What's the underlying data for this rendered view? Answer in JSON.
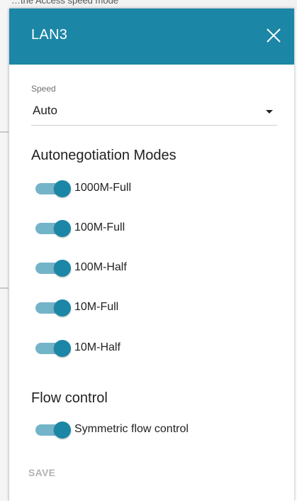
{
  "background": {
    "partial_text": "…the Access speed mode"
  },
  "dialog": {
    "title": "LAN3",
    "close_icon": "close-icon",
    "header_color": "#1b86a6"
  },
  "speed": {
    "label": "Speed",
    "value": "Auto"
  },
  "autonegotiation": {
    "title": "Autonegotiation Modes",
    "modes": [
      {
        "label": "1000M-Full",
        "enabled": true
      },
      {
        "label": "100M-Full",
        "enabled": true
      },
      {
        "label": "100M-Half",
        "enabled": true
      },
      {
        "label": "10M-Full",
        "enabled": true
      },
      {
        "label": "10M-Half",
        "enabled": true
      }
    ]
  },
  "flow_control": {
    "title": "Flow control",
    "symmetric": {
      "label": "Symmetric flow control",
      "enabled": true
    }
  },
  "actions": {
    "save_label": "SAVE",
    "save_enabled": false
  },
  "colors": {
    "accent": "#1b86a6",
    "toggle_track": "#74b4c9",
    "disabled_text": "#b3b3b3"
  }
}
